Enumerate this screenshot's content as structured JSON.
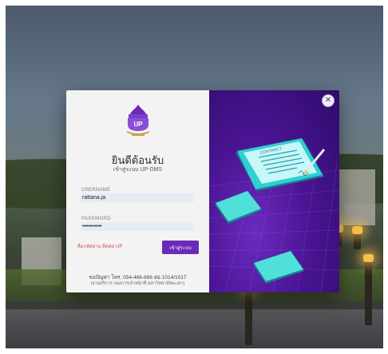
{
  "login": {
    "welcome_title": "ยินดีต้อนรับ",
    "subtitle": "เข้าสู่ระบบ UP-DMS",
    "username_label": "USERNAME",
    "username_value": "rattana.ja",
    "password_label": "PASSWORD",
    "password_value": "••••••••••",
    "forgot_link": "ลืมรหัสผ่าน ติดต่อ UP",
    "login_button": "เข้าสู่ระบบ",
    "footer_contact": "ขอปัญหา โทร. 054-466-666 ต่อ 1014/1017",
    "footer_dept": "(งานบริการ กองการเจ้าหน้าที่ มหาวิทยาลัยพะเยา)",
    "close_icon": "close-icon",
    "logo": "university-logo"
  },
  "illustration": {
    "card_title": "CONTRACT",
    "icons": [
      "phone-icon",
      "document-icon",
      "pen-icon"
    ]
  },
  "colors": {
    "accent": "#6a2ab9",
    "panel_bg": "#f3f3f3",
    "illustration_bg": "#4a1593",
    "forgot_link": "#d84b4b",
    "field_bg": "#e6ecf6"
  }
}
